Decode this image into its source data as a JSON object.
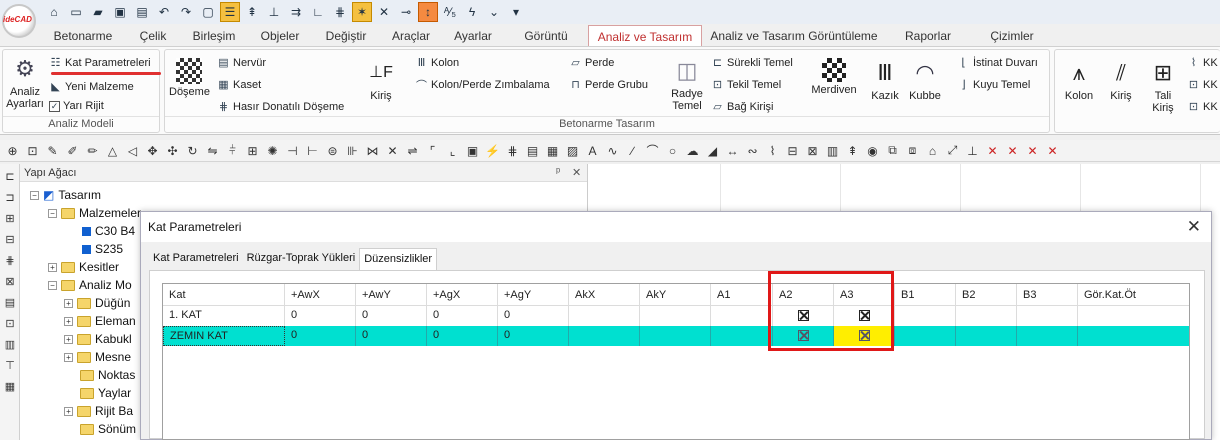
{
  "app": {
    "logo_text": "ideCAD"
  },
  "tabs": [
    "Betonarme",
    "Çelik",
    "Birleşim",
    "Objeler",
    "Değiştir",
    "Araçlar",
    "Ayarlar",
    "Görüntü",
    "Analiz ve Tasarım",
    "Analiz ve Tasarım Görüntüleme",
    "Raporlar",
    "Çizimler"
  ],
  "active_tab": "Analiz ve Tasarım",
  "ribbon": {
    "analiz_ayarlari": "Analiz Ayarları",
    "kat_parametreleri": "Kat Parametreleri",
    "yeni_malzeme": "Yeni Malzeme",
    "yari_rijit": "Yarı Rijit",
    "group_analiz_modeli": "Analiz Modeli",
    "doseme": "Döşeme",
    "nervur": "Nervür",
    "kaset": "Kaset",
    "hasir": "Hasır Donatılı Döşeme",
    "kiris": "Kiriş",
    "kolon": "Kolon",
    "kolon_perde_zimbalama": "Kolon/Perde Zımbalama",
    "perde": "Perde",
    "perde_grubu": "Perde Grubu",
    "radye_temel": "Radye Temel",
    "surekli_temel": "Sürekli Temel",
    "tekil_temel": "Tekil Temel",
    "bag_kirisi": "Bağ Kirişi",
    "merdiven": "Merdiven",
    "kazik": "Kazık",
    "kubbe": "Kubbe",
    "istinat_duvari": "İstinat Duvarı",
    "kuyu_temel": "Kuyu Temel",
    "group_betonarme_tasarim": "Betonarme Tasarım",
    "celik_kolon": "Kolon",
    "celik_kiris": "Kiriş",
    "tali_kiris": "Tali Kiriş",
    "kk1": "KK",
    "kk2": "KK",
    "kk3": "KK"
  },
  "tree": {
    "title": "Yapı Ağacı",
    "pin": "ᵖ",
    "close": "✕",
    "items": [
      "Tasarım",
      "Malzemeler",
      "C30 B4",
      "S235",
      "Kesitler",
      "Analiz Mo",
      "Düğün",
      "Eleman",
      "Kabukl",
      "Mesne",
      "Noktas",
      "Yaylar",
      "Rijit Ba",
      "Sönüm"
    ]
  },
  "dialog": {
    "title": "Kat Parametreleri",
    "close": "✕",
    "tabs": [
      "Kat Parametreleri",
      "Rüzgar-Toprak Yükleri",
      "Düzensizlikler"
    ],
    "active_tab": "Düzensizlikler",
    "columns": [
      "Kat",
      "+AwX",
      "+AwY",
      "+AgX",
      "+AgY",
      "AkX",
      "AkY",
      "A1",
      "A2",
      "A3",
      "B1",
      "B2",
      "B3",
      "Gör.Kat.Öt"
    ],
    "rows": [
      {
        "kat": "1. KAT",
        "awx": "0",
        "awy": "0",
        "agx": "0",
        "agy": "0",
        "a2": true,
        "a3": true,
        "selected": false
      },
      {
        "kat": "ZEMIN KAT",
        "awx": "0",
        "awy": "0",
        "agx": "0",
        "agy": "0",
        "a2": true,
        "a3": true,
        "selected": true
      }
    ]
  },
  "colors": {
    "selected_row": "#00e0d0",
    "highlight_cell": "#ffee00",
    "annotation": "#e01818"
  }
}
